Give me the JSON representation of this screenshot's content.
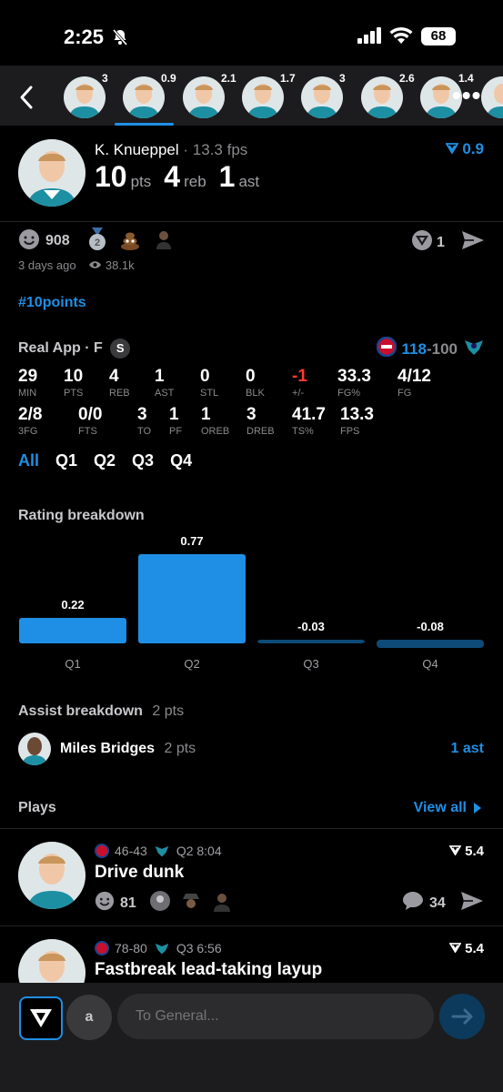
{
  "status": {
    "time": "2:25",
    "battery": "68"
  },
  "strip": {
    "values": [
      "3",
      "0.9",
      "2.1",
      "1.7",
      "3",
      "2.6",
      "1.4"
    ]
  },
  "player": {
    "name": "K. Knueppel",
    "fps": "13.3 fps",
    "pts": "10",
    "pts_unit": "pts",
    "reb": "4",
    "reb_unit": "reb",
    "ast": "1",
    "ast_unit": "ast",
    "rating": "0.9",
    "sep": "·"
  },
  "reactions": {
    "count": "908",
    "medal_num": "2",
    "share_count": "1",
    "posted": "3 days ago",
    "views": "38.1k"
  },
  "hashtag": "#10points",
  "game": {
    "source": "Real App · F",
    "badge": "S",
    "score_home": "118",
    "score_sep": "-",
    "score_away": "100"
  },
  "box": [
    {
      "v": "29",
      "l": "MIN"
    },
    {
      "v": "10",
      "l": "PTS"
    },
    {
      "v": "4",
      "l": "REB"
    },
    {
      "v": "1",
      "l": "AST"
    },
    {
      "v": "0",
      "l": "STL"
    },
    {
      "v": "0",
      "l": "BLK"
    },
    {
      "v": "-1",
      "l": "+/-"
    },
    {
      "v": "33.3",
      "l": "FG%"
    },
    {
      "v": "4/12",
      "l": "FG"
    },
    {
      "v": "2/8",
      "l": "3FG"
    },
    {
      "v": "0/0",
      "l": "FTS"
    },
    {
      "v": "3",
      "l": "TO"
    },
    {
      "v": "1",
      "l": "PF"
    },
    {
      "v": "1",
      "l": "OREB"
    },
    {
      "v": "3",
      "l": "DREB"
    },
    {
      "v": "41.7",
      "l": "TS%"
    },
    {
      "v": "13.3",
      "l": "FPS"
    }
  ],
  "tabs": [
    "All",
    "Q1",
    "Q2",
    "Q3",
    "Q4"
  ],
  "rating_title": "Rating breakdown",
  "chart_data": {
    "type": "bar",
    "categories": [
      "Q1",
      "Q2",
      "Q3",
      "Q4"
    ],
    "values": [
      0.22,
      0.77,
      -0.03,
      -0.08
    ],
    "labels": [
      "0.22",
      "0.77",
      "-0.03",
      "-0.08"
    ],
    "title": "",
    "colors": {
      "positive": "#1f8fe5",
      "negative": "#0d4a78"
    }
  },
  "assist": {
    "title": "Assist breakdown",
    "title_pts": "2 pts",
    "name": "Miles Bridges",
    "pts": "2 pts",
    "count": "1 ast"
  },
  "plays": {
    "title": "Plays",
    "view_all": "View all",
    "items": [
      {
        "score": "46-43",
        "clock": "Q2 8:04",
        "title": "Drive dunk",
        "rating": "5.4",
        "reactions": "81",
        "comments": "34"
      },
      {
        "score": "78-80",
        "clock": "Q3 6:56",
        "title": "Fastbreak lead-taking layup",
        "rating": "5.4"
      }
    ]
  },
  "composer": {
    "avatar_letter": "a",
    "placeholder": "To General..."
  },
  "colors": {
    "accent": "#1f8fe5",
    "negative": "#ff3b30",
    "bg": "#000000",
    "panel": "#1c1c1e"
  }
}
